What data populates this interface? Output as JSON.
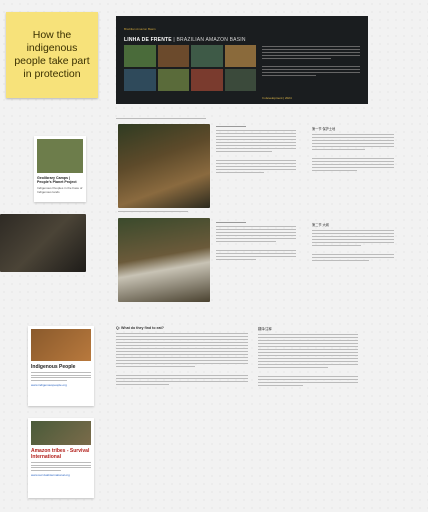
{
  "sticky": {
    "text": "How the indigenous people take part in protection"
  },
  "banner": {
    "kicker": "Brazilian Amazon Basin",
    "title_main": "LINHA DE FRENTE",
    "title_sep": " | ",
    "title_sub": "BRAZILIAN AMAZON BASIN",
    "status": "In development  |  2024"
  },
  "cards": {
    "geo": {
      "title": "Geo​library Camps | People's Planet Project",
      "subtitle": "Indigenous Peoples in the Face of Indigenous lands"
    },
    "indigenous": {
      "title": "Indigenous People",
      "link": "www.indigenouspeople.org"
    },
    "amazon": {
      "title": "Amazon tribes - Survival International",
      "link": "www.survivalinternational.org"
    }
  },
  "sections": {
    "q_title": "Q: What do they find to eat?",
    "right_heading_1": "第一节 保护土地",
    "right_heading_2": "第二节 大纲",
    "right_heading_3": "翻译/注释"
  },
  "colors": {
    "sticky": "#f7e27a",
    "banner": "#1a1d1f",
    "accent": "#e0b94a",
    "link": "#2d66c2"
  }
}
